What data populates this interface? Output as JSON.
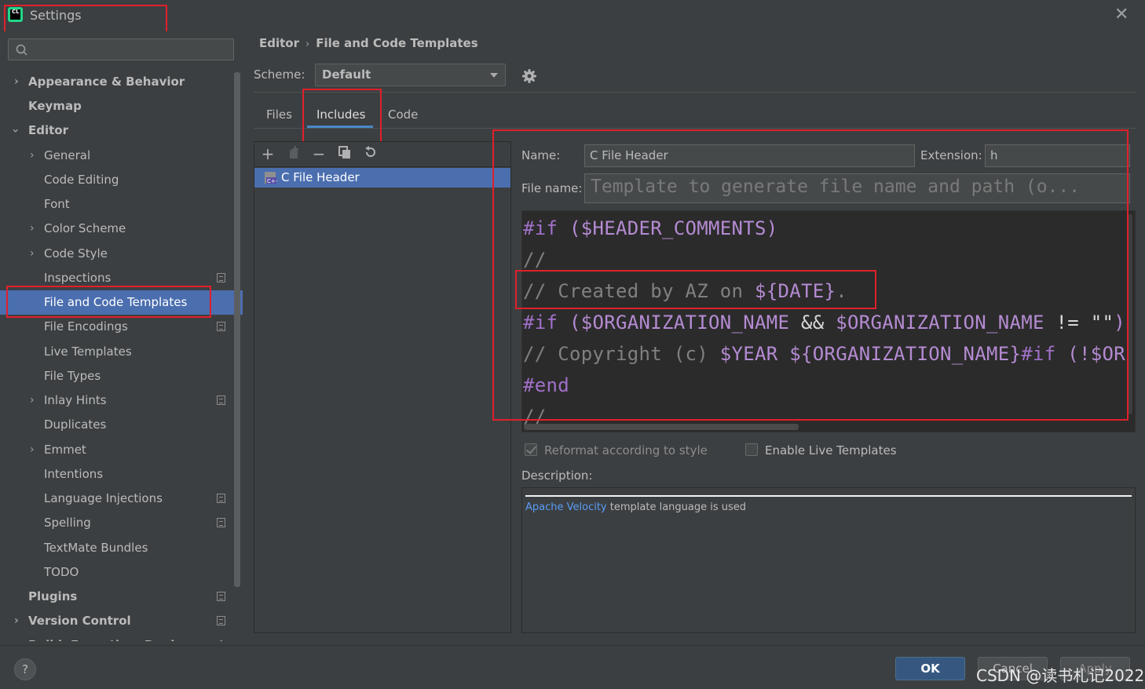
{
  "window": {
    "title": "Settings",
    "app_icon_text": "CL"
  },
  "sidebar": {
    "search_placeholder": "",
    "items": [
      {
        "label": "Appearance & Behavior"
      },
      {
        "label": "Keymap"
      },
      {
        "label": "Editor"
      },
      {
        "label": "General"
      },
      {
        "label": "Code Editing"
      },
      {
        "label": "Font"
      },
      {
        "label": "Color Scheme"
      },
      {
        "label": "Code Style"
      },
      {
        "label": "Inspections"
      },
      {
        "label": "File and Code Templates"
      },
      {
        "label": "File Encodings"
      },
      {
        "label": "Live Templates"
      },
      {
        "label": "File Types"
      },
      {
        "label": "Inlay Hints"
      },
      {
        "label": "Duplicates"
      },
      {
        "label": "Emmet"
      },
      {
        "label": "Intentions"
      },
      {
        "label": "Language Injections"
      },
      {
        "label": "Spelling"
      },
      {
        "label": "TextMate Bundles"
      },
      {
        "label": "TODO"
      },
      {
        "label": "Plugins"
      },
      {
        "label": "Version Control"
      },
      {
        "label": "Build, Execution, Deployment"
      }
    ]
  },
  "breadcrumb": {
    "parent": "Editor",
    "separator": "›",
    "current": "File and Code Templates"
  },
  "scheme": {
    "label": "Scheme:",
    "value": "Default"
  },
  "tabs": [
    {
      "label": "Files"
    },
    {
      "label": "Includes"
    },
    {
      "label": "Code"
    }
  ],
  "templates_list": {
    "items": [
      {
        "label": "C File Header"
      }
    ]
  },
  "form": {
    "name_label": "Name:",
    "name_value": "C File Header",
    "extension_label": "Extension:",
    "extension_value": "h",
    "filename_label": "File name:",
    "filename_placeholder": "Template to generate file name and path (o..."
  },
  "editor": {
    "line1_kw": "#if",
    "line1_rest": " ($HEADER_COMMENTS)",
    "line2": "//",
    "line3_comment": "// Created by AZ on ",
    "line3_var": "${DATE}",
    "line3_end": ".",
    "line4_kw": "#if",
    "line4_a": " ($ORGANIZATION_NAME",
    "line4_op": " && ",
    "line4_b": "$ORGANIZATION_NAME",
    "line4_op2": " != ",
    "line4_str": "\"\"",
    "line4_end": ")",
    "line5_comment": "// Copyright (c) ",
    "line5_var1": "$YEAR",
    "line5_sp": " ",
    "line5_var2": "${ORGANIZATION_NAME}",
    "line5_kw": "#if",
    "line5_rest": " (!$OR",
    "line6_kw": "#end",
    "line7": "//"
  },
  "options": {
    "reformat_label": "Reformat according to style",
    "reformat_checked": true,
    "live_templates_label": "Enable Live Templates",
    "live_templates_checked": false
  },
  "description": {
    "label": "Description:",
    "link_text": "Apache Velocity",
    "text": " template language is used"
  },
  "footer": {
    "help": "?",
    "ok": "OK",
    "cancel": "Cancel",
    "apply": "Apply",
    "watermark": "CSDN @读书札记2022"
  }
}
